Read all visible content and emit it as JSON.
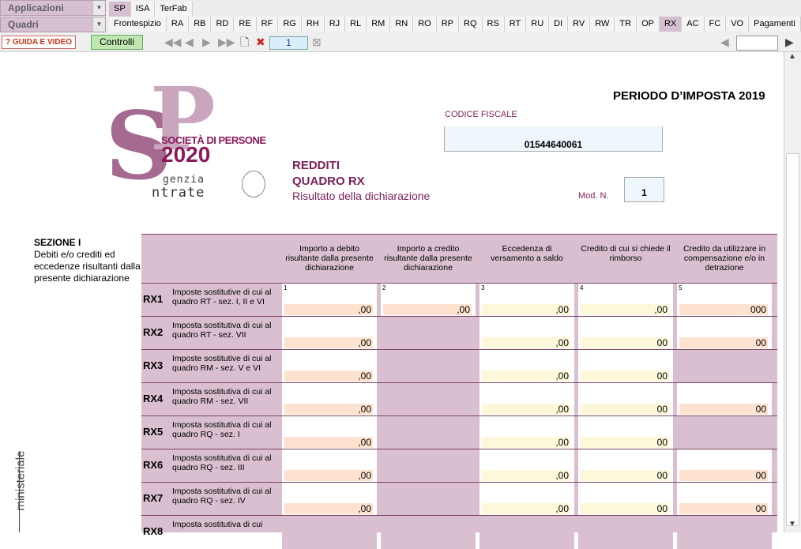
{
  "app_combo": {
    "label": "Applicazioni"
  },
  "quadri_combo": {
    "label": "Quadri"
  },
  "top_tabs": [
    {
      "label": "SP",
      "active": true
    },
    {
      "label": "ISA",
      "active": false
    },
    {
      "label": "TerFab",
      "active": false
    }
  ],
  "quadri_tabs": [
    {
      "label": "Frontespizio",
      "active": false
    },
    {
      "label": "RA",
      "active": false
    },
    {
      "label": "RB",
      "active": false
    },
    {
      "label": "RD",
      "active": false
    },
    {
      "label": "RE",
      "active": false
    },
    {
      "label": "RF",
      "active": false
    },
    {
      "label": "RG",
      "active": false
    },
    {
      "label": "RH",
      "active": false
    },
    {
      "label": "RJ",
      "active": false
    },
    {
      "label": "RL",
      "active": false
    },
    {
      "label": "RM",
      "active": false
    },
    {
      "label": "RN",
      "active": false
    },
    {
      "label": "RO",
      "active": false
    },
    {
      "label": "RP",
      "active": false
    },
    {
      "label": "RQ",
      "active": false
    },
    {
      "label": "RS",
      "active": false
    },
    {
      "label": "RT",
      "active": false
    },
    {
      "label": "RU",
      "active": false
    },
    {
      "label": "DI",
      "active": false
    },
    {
      "label": "RV",
      "active": false
    },
    {
      "label": "RW",
      "active": false
    },
    {
      "label": "TR",
      "active": false
    },
    {
      "label": "OP",
      "active": false
    },
    {
      "label": "RX",
      "active": true
    },
    {
      "label": "AC",
      "active": false
    },
    {
      "label": "FC",
      "active": false
    },
    {
      "label": "VO",
      "active": false
    },
    {
      "label": "Pagamenti",
      "active": false
    }
  ],
  "toolbar": {
    "guida_label": "GUIDA E VIDEO",
    "controlli_label": "Controlli",
    "page_number": "1"
  },
  "form": {
    "logo": {
      "sp": "SP",
      "societa": "SOCIETÀ DI PERSONE",
      "year": "2020",
      "agenzia": "genzia",
      "entrate": "ntrate"
    },
    "periodo": "PERIODO D’IMPOSTA 2019",
    "codice_fiscale_label": "CODICE FISCALE",
    "codice_fiscale_value": "01544640061",
    "redditi": "REDDITI",
    "quadro": "QUADRO RX",
    "risultato": "Risultato della dichiarazione",
    "mod_n_label": "Mod. N.",
    "mod_n_value": "1",
    "sezione_title": "SEZIONE I",
    "sezione_desc": "Debiti e/o crediti ed eccedenze risultanti dalla presente dichiarazione",
    "ministeriale": "ministeriale",
    "columns": [
      "Importo a debito risultante dalla presente dichiarazione",
      "Importo a credito risultante dalla presente dichiarazione",
      "Eccedenza di versamento a saldo",
      "Credito di cui si chiede il rimborso",
      "Credito da utilizzare in compensazione e/o in detrazione"
    ],
    "col_numbers": [
      "1",
      "2",
      "3",
      "4",
      "5"
    ],
    "rows": [
      {
        "code": "RX1",
        "desc": "Imposte sostitutive di cui al quadro RT - sez. I, II e VI",
        "values": [
          ",00",
          ",00",
          ",00",
          ",00",
          "000"
        ]
      },
      {
        "code": "RX2",
        "desc": "Imposta sostitutiva di cui al quadro RT - sez. VII",
        "values": [
          ",00",
          null,
          ",00",
          "00",
          "00"
        ]
      },
      {
        "code": "RX3",
        "desc": "Imposte sostitutive di cui al quadro RM - sez. V e VI",
        "values": [
          ",00",
          null,
          ",00",
          "00",
          null
        ]
      },
      {
        "code": "RX4",
        "desc": "Imposta sostitutiva di cui al quadro RM - sez. VII",
        "values": [
          ",00",
          null,
          ",00",
          "00",
          "00"
        ]
      },
      {
        "code": "RX5",
        "desc": "Imposta sostitutiva di cui al quadro RQ - sez. I",
        "values": [
          ",00",
          null,
          ",00",
          "00",
          null
        ]
      },
      {
        "code": "RX6",
        "desc": "Imposta sostitutiva di cui al quadro RQ - sez. III",
        "values": [
          ",00",
          null,
          ",00",
          "00",
          "00"
        ]
      },
      {
        "code": "RX7",
        "desc": "Imposta sostitutiva di cui al quadro RQ - sez. IV",
        "values": [
          ",00",
          null,
          ",00",
          "00",
          "00"
        ]
      },
      {
        "code": "RX8",
        "desc": "Imposta sostitutiva di cui",
        "values": [
          null,
          null,
          null,
          null,
          null
        ]
      }
    ]
  }
}
